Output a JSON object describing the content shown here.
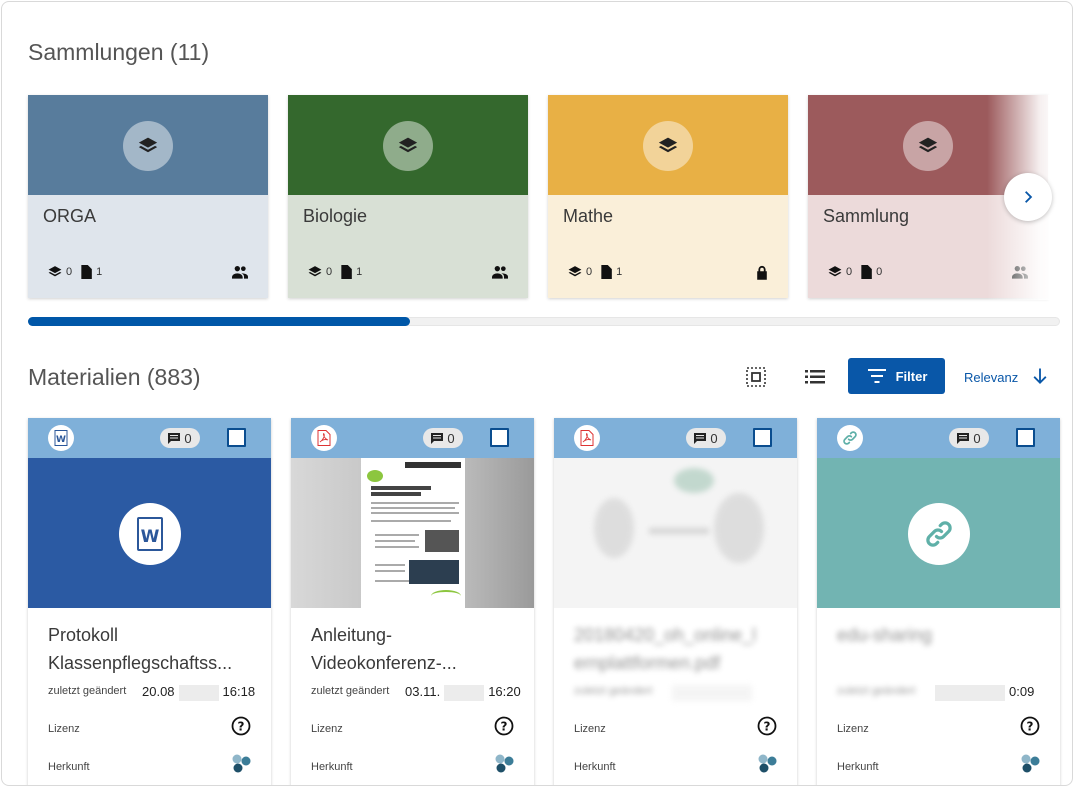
{
  "collections": {
    "title": "Sammlungen (11)",
    "items": [
      {
        "name": "ORGA",
        "collections": "0",
        "materials": "1",
        "access": "group-icon",
        "head_color": "#587c9c",
        "body_color": "#dfe5ec"
      },
      {
        "name": "Biologie",
        "collections": "0",
        "materials": "1",
        "access": "group-icon",
        "head_color": "#34682d",
        "body_color": "#d8e0d5"
      },
      {
        "name": "Mathe",
        "collections": "0",
        "materials": "1",
        "access": "lock-icon",
        "head_color": "#e8b045",
        "body_color": "#faefd9"
      },
      {
        "name": "Sammlung",
        "collections": "0",
        "materials": "0",
        "access": "group-icon",
        "head_color": "#9c5a5c",
        "body_color": "#ecdada"
      }
    ],
    "scroll_progress": 0.37
  },
  "materials": {
    "title": "Materialien (883)",
    "toolbar": {
      "filter_label": "Filter",
      "sort_label": "Relevanz",
      "accent_color": "#0957a8"
    },
    "label_changed": "zuletzt geändert",
    "label_license": "Lizenz",
    "label_origin": "Herkunft",
    "items": [
      {
        "type": "word-icon",
        "comments": "0",
        "title_line1": "Protokoll",
        "title_line2": "Klassenpflegschaftss...",
        "date_start": "20.08",
        "date_end": "16:18"
      },
      {
        "type": "pdf-icon",
        "comments": "0",
        "title_line1": "Anleitung-",
        "title_line2": "Videokonferenz-...",
        "date_start": "03.11.",
        "date_end": "16:20"
      },
      {
        "type": "pdf-icon",
        "comments": "0",
        "title_line1": "20180420_oh_online_l",
        "title_line2": "ernplattformen.pdf",
        "date_start": "",
        "date_end": ""
      },
      {
        "type": "link-icon",
        "comments": "0",
        "title_line1": "edu-sharing",
        "title_line2": "",
        "date_start": "",
        "date_end": "0:09"
      }
    ]
  }
}
